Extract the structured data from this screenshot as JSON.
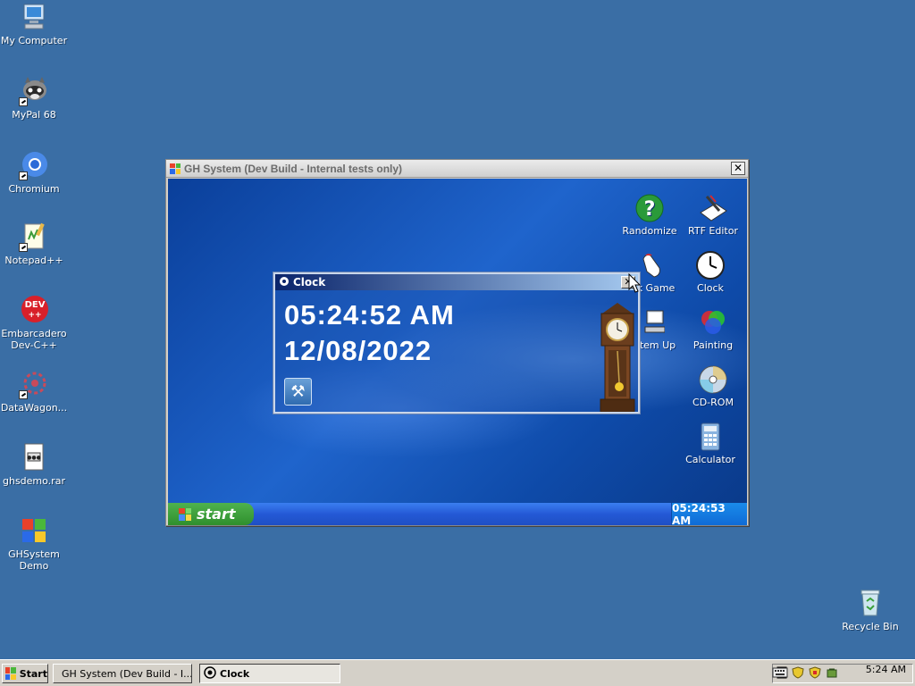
{
  "desktop_icons": [
    {
      "id": "my-computer",
      "label": "My Computer"
    },
    {
      "id": "mypal",
      "label": "MyPal 68"
    },
    {
      "id": "chromium",
      "label": "Chromium"
    },
    {
      "id": "notepadpp",
      "label": "Notepad++"
    },
    {
      "id": "devcpp",
      "label": "Embarcadero Dev-C++",
      "badge": "DEV"
    },
    {
      "id": "datawagon",
      "label": "DataWagon..."
    },
    {
      "id": "ghsdemo",
      "label": "ghsdemo.rar"
    },
    {
      "id": "ghsystem-demo",
      "label": "GHSystem Demo"
    },
    {
      "id": "recycle-bin",
      "label": "Recycle Bin"
    }
  ],
  "gh_window": {
    "title": "GH System (Dev Build - Internal tests only)",
    "close_label": "✕",
    "icons": [
      {
        "id": "randomize",
        "label": "Randomize",
        "glyph": "?"
      },
      {
        "id": "rtf-editor",
        "label": "RTF Editor"
      },
      {
        "id": "click-game",
        "label": "k Game"
      },
      {
        "id": "clock",
        "label": "Clock"
      },
      {
        "id": "system-up",
        "label": "tem Up"
      },
      {
        "id": "painting",
        "label": "Painting"
      },
      {
        "id": "cd-rom",
        "label": "CD-ROM"
      },
      {
        "id": "calculator",
        "label": "Calculator"
      }
    ],
    "taskbar": {
      "start_label": "start",
      "clock": "05:24:53 AM"
    }
  },
  "clock_window": {
    "title": "Clock",
    "close_label": "✕",
    "time": "05:24:52 AM",
    "date": "12/08/2022"
  },
  "taskbar": {
    "start_label": "Start",
    "tasks": [
      {
        "id": "gh-system",
        "label": "GH System (Dev Build - I..."
      },
      {
        "id": "clock",
        "label": "Clock"
      }
    ],
    "time": "5:24 AM"
  },
  "colors": {
    "desktop": "#3a6ea5",
    "xp_start_green": "#3a9a38",
    "xp_taskbar_blue": "#2459d6",
    "classic_gray": "#d4d0c8"
  }
}
